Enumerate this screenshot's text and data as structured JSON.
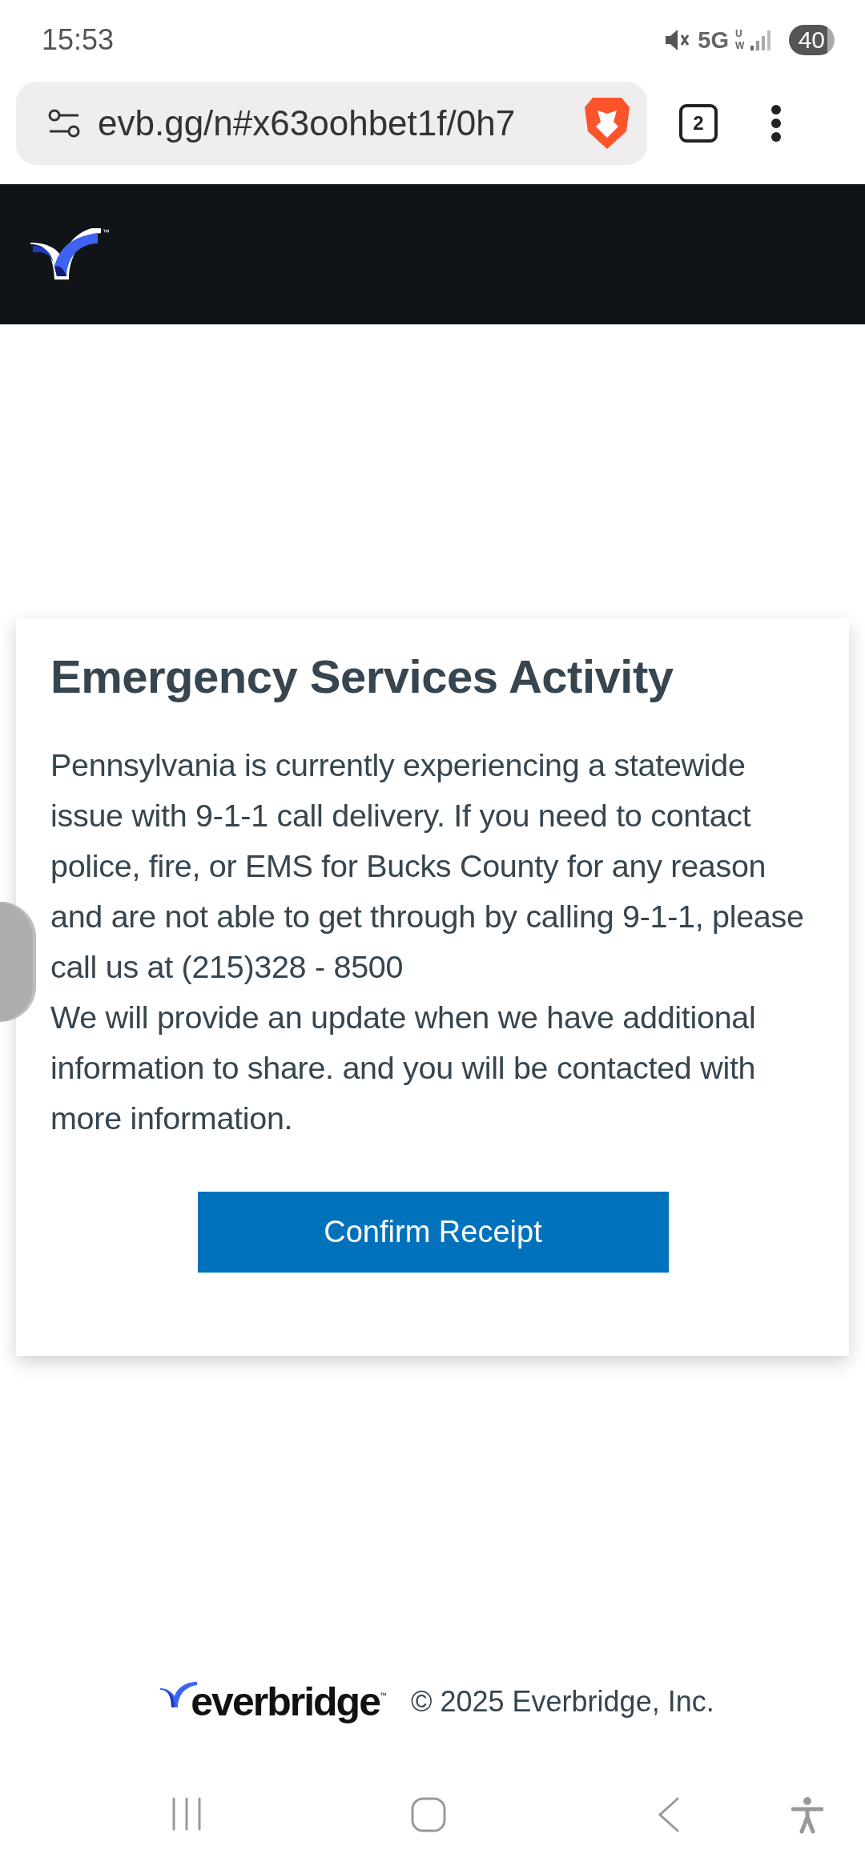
{
  "status_bar": {
    "time": "15:53",
    "network": "5G",
    "network_sub": "UW",
    "battery": "40"
  },
  "browser": {
    "url": "evb.gg/n#x63oohbet1f/0h7",
    "tab_count": "2"
  },
  "header": {
    "logo_mark": "™"
  },
  "alert": {
    "title": "Emergency Services Activity",
    "paragraphs": [
      "Pennsylvania is currently experiencing a statewide issue with 9-1-1 call delivery. If you need to contact police, fire, or EMS for Bucks County for any reason and are not able to get through by calling 9-1-1, please call us at (215)328 - 8500",
      "We will provide an update when we have additional information to share. and you will be contacted with more information."
    ],
    "button": "Confirm Receipt"
  },
  "footer": {
    "brand": "everbridge",
    "brand_mark": "™",
    "copyright": "© 2025 Everbridge, Inc."
  }
}
